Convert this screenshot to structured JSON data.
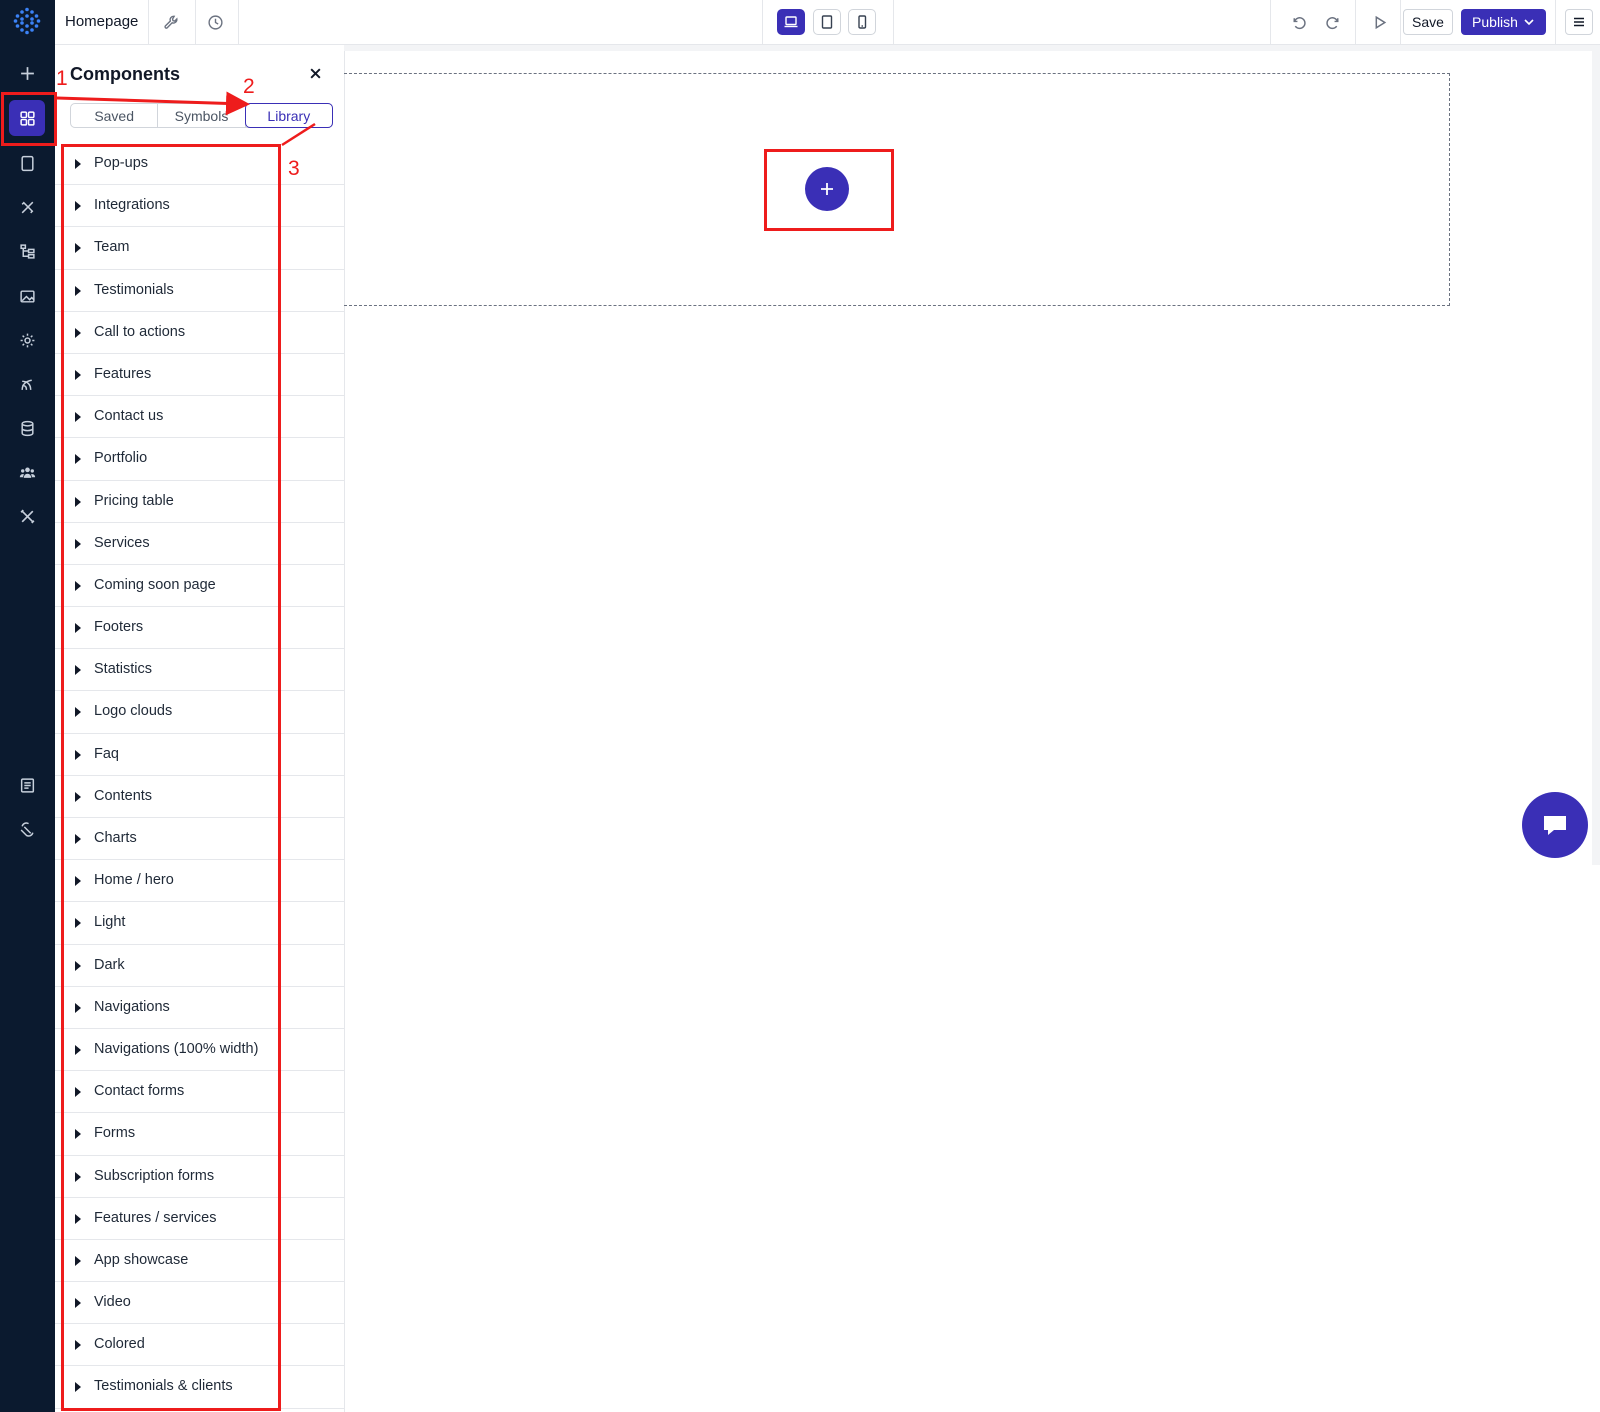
{
  "topbar": {
    "page_title": "Homepage",
    "save_label": "Save",
    "publish_label": "Publish"
  },
  "panel": {
    "title": "Components",
    "tabs": [
      {
        "label": "Saved",
        "active": false
      },
      {
        "label": "Symbols",
        "active": false
      },
      {
        "label": "Library",
        "active": true
      }
    ],
    "items": [
      "Pop-ups",
      "Integrations",
      "Team",
      "Testimonials",
      "Call to actions",
      "Features",
      "Contact us",
      "Portfolio",
      "Pricing table",
      "Services",
      "Coming soon page",
      "Footers",
      "Statistics",
      "Logo clouds",
      "Faq",
      "Contents",
      "Charts",
      "Home / hero",
      "Light",
      "Dark",
      "Navigations",
      "Navigations (100% width)",
      "Contact forms",
      "Forms",
      "Subscription forms",
      "Features / services",
      "App showcase",
      "Video",
      "Colored",
      "Testimonials & clients"
    ]
  },
  "annotations": {
    "n1": "1",
    "n2": "2",
    "n3": "3"
  },
  "colors": {
    "accent": "#3a2fb6",
    "rail": "#0b1a2f",
    "annotation": "#ee1c1c"
  },
  "icons": {
    "rail": [
      "plus-icon",
      "components-icon",
      "page-icon",
      "design-icon",
      "sitemap-icon",
      "image-icon",
      "settings-icon",
      "integrations-icon",
      "database-icon",
      "users-icon",
      "tools-icon",
      "docs-icon",
      "support-icon"
    ],
    "topbar": [
      "wrench-icon",
      "history-icon",
      "desktop-icon",
      "tablet-icon",
      "mobile-icon",
      "undo-icon",
      "redo-icon",
      "preview-play-icon",
      "chevron-down-icon",
      "hamburger-menu-icon"
    ]
  }
}
